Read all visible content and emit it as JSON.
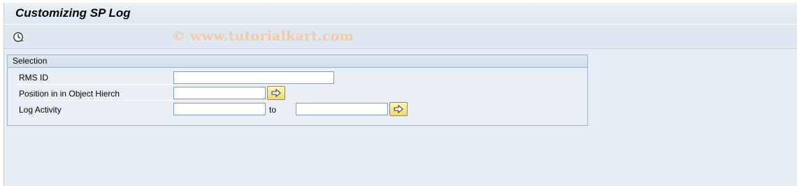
{
  "page": {
    "title": "Customizing SP Log"
  },
  "toolbar": {
    "execute_icon": "execute-clock-icon",
    "watermark": "© www.tutorialkart.com"
  },
  "selection": {
    "title": "Selection",
    "fields": [
      {
        "label": "RMS ID",
        "value": ""
      },
      {
        "label": "Position in in Object Hierch",
        "value": ""
      },
      {
        "label": "Log Activity",
        "from": "",
        "to_label": "to",
        "to": ""
      }
    ],
    "multi_select_icon": "arrow-right-icon"
  },
  "colors": {
    "background": "#e6edf4",
    "group_border": "#9fb3c8",
    "button": "#f0d86b"
  }
}
